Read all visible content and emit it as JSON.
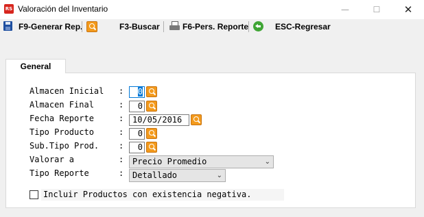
{
  "window": {
    "title": "Valoración del Inventario",
    "icon_text": "RS",
    "minimize_glyph": "—",
    "maximize_glyph": "☐",
    "close_glyph": "✕"
  },
  "toolbar": {
    "generate_label": "F9-Generar Rep.",
    "search_label": "F3-Buscar",
    "custom_report_label": "F6-Pers. Reporte",
    "back_label": "ESC-Regresar"
  },
  "tabs": [
    {
      "label": "General"
    }
  ],
  "form": {
    "almacen_inicial": {
      "label": "Almacen Inicial",
      "value": "0"
    },
    "almacen_final": {
      "label": "Almacen Final",
      "value": "0"
    },
    "fecha_reporte": {
      "label": "Fecha Reporte",
      "value": "10/05/2016"
    },
    "tipo_producto": {
      "label": "Tipo Producto",
      "value": "0"
    },
    "sub_tipo_prod": {
      "label": "Sub.Tipo Prod.",
      "value": "0"
    },
    "valorar_a": {
      "label": "Valorar a",
      "value": "Precio Promedio"
    },
    "tipo_reporte": {
      "label": "Tipo Reporte",
      "value": "Detallado"
    },
    "colon": ":",
    "include_negative": {
      "label": "Incluir Productos con existencia negativa.",
      "checked": false
    }
  },
  "icons": {
    "app": "app-logo-icon",
    "save": "save-icon",
    "search": "search-icon",
    "print": "print-icon",
    "back": "back-arrow-icon",
    "dropdown": "chevron-down-icon"
  },
  "colors": {
    "search_orange": "#f39a1c",
    "back_green": "#3fa535",
    "save_blue": "#1e4fa0",
    "selection_blue": "#0078d7"
  }
}
